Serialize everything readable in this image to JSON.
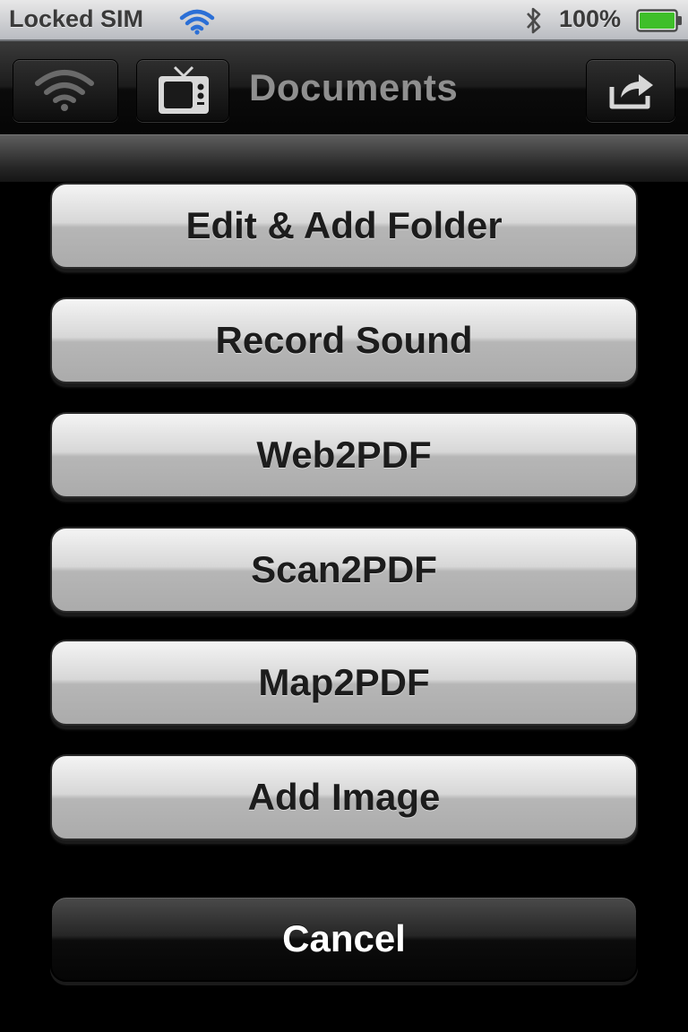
{
  "status_bar": {
    "carrier": "Locked SIM",
    "battery_percent": "100%",
    "wifi_icon": "wifi-icon",
    "bluetooth_icon": "bluetooth-icon",
    "battery_icon": "battery-icon",
    "battery_level": 1.0,
    "wifi_color": "#2b6fd6",
    "battery_color": "#3fbf2a"
  },
  "nav_bar": {
    "title": "Documents",
    "left_buttons": [
      {
        "icon": "wifi-icon"
      },
      {
        "icon": "tv-icon"
      }
    ],
    "right_button": {
      "icon": "share-icon"
    }
  },
  "action_sheet": {
    "buttons": [
      {
        "label": "Edit & Add Folder"
      },
      {
        "label": "Record Sound"
      },
      {
        "label": "Web2PDF"
      },
      {
        "label": "Scan2PDF"
      },
      {
        "label": "Map2PDF"
      },
      {
        "label": "Add Image"
      }
    ],
    "cancel_label": "Cancel"
  }
}
